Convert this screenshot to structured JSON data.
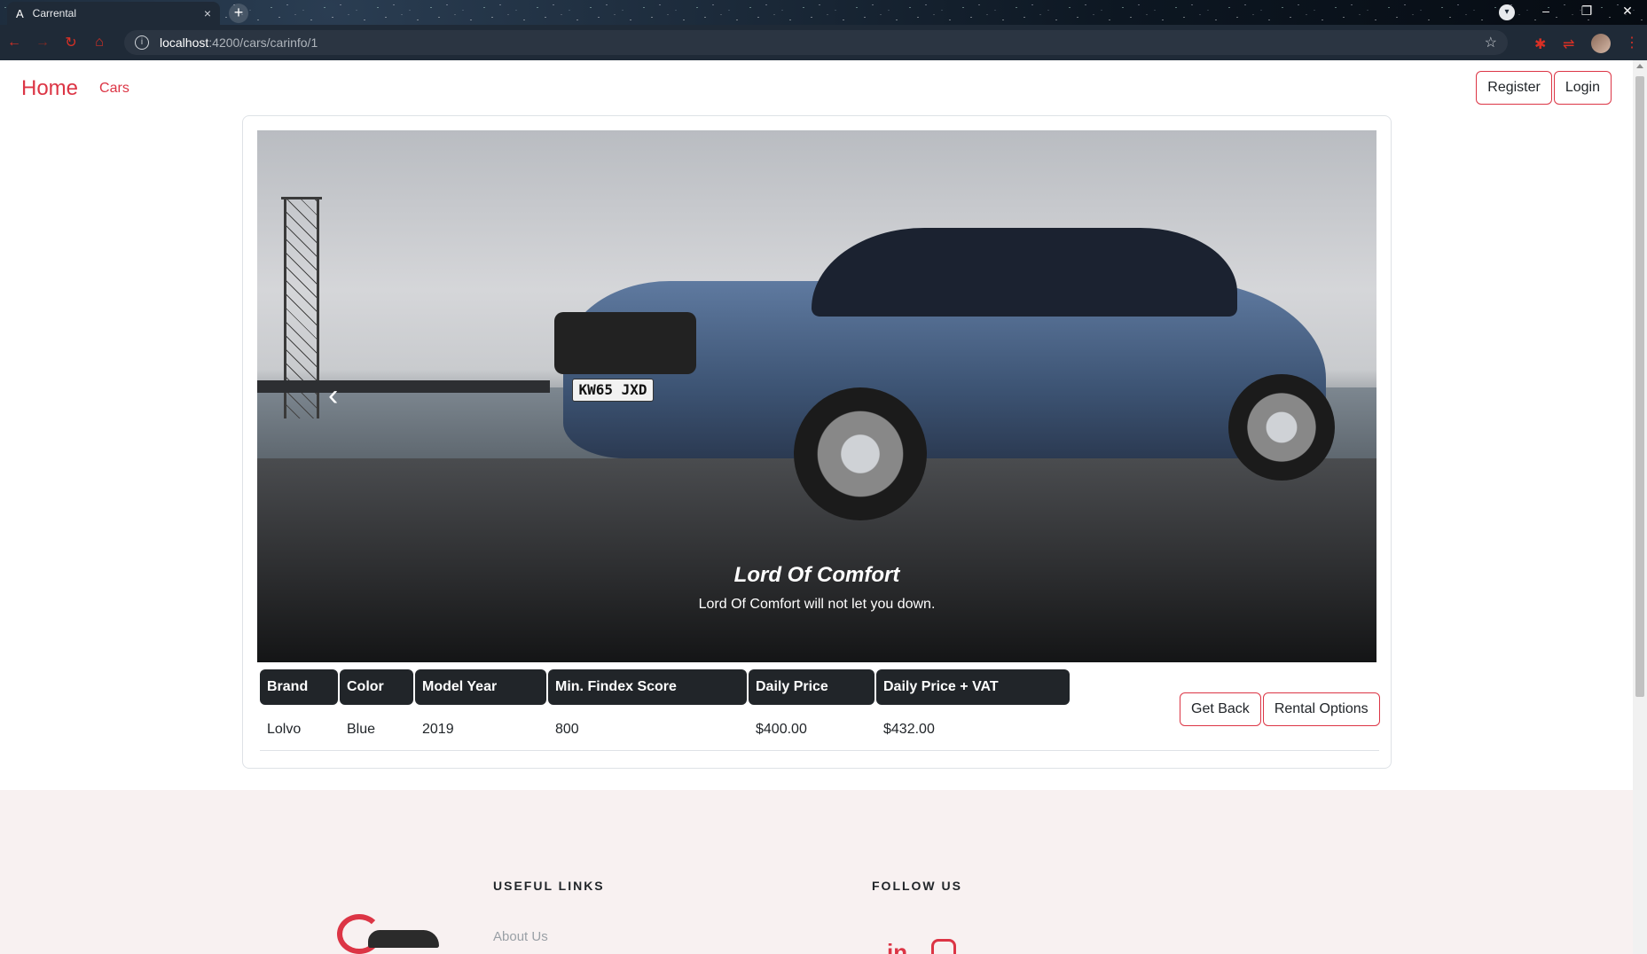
{
  "browser": {
    "tab_title": "Carrental",
    "tab_close": "×",
    "new_tab": "+",
    "url_host": "localhost",
    "url_path": ":4200/cars/carinfo/1"
  },
  "navbar": {
    "brand": "Home",
    "link_cars": "Cars",
    "register": "Register",
    "login": "Login"
  },
  "carousel": {
    "plate": "KW65 JXD",
    "caption_title": "Lord Of Comfort",
    "caption_text": "Lord Of Comfort will not let you down."
  },
  "specs": {
    "headers": [
      "Brand",
      "Color",
      "Model Year",
      "Min. Findex Score",
      "Daily Price",
      "Daily Price + VAT"
    ],
    "row": [
      "Lolvo",
      "Blue",
      "2019",
      "800",
      "$400.00",
      "$432.00"
    ]
  },
  "actions": {
    "get_back": "Get Back",
    "rental_options": "Rental Options"
  },
  "footer": {
    "useful_links_title": "USEFUL LINKS",
    "follow_us_title": "FOLLOW US",
    "about_link": "About Us",
    "linkedin": "in"
  },
  "colors": {
    "accent": "#dc3545",
    "table_header_bg": "#212529",
    "footer_bg": "#f8f1f1"
  }
}
